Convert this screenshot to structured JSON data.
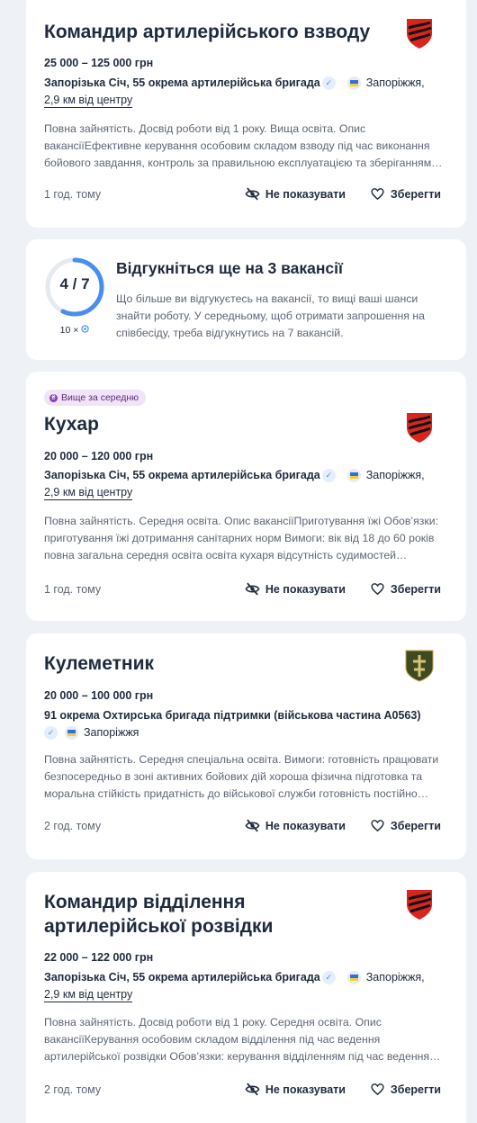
{
  "colors": {
    "background": "#eef2f6",
    "card": "#ffffff",
    "text": "#1f2b3d",
    "muted": "#5d6675",
    "accent": "#4a8df0",
    "badge_bg": "#f1e4f8"
  },
  "labels": {
    "hide": "Не показувати",
    "save": "Зберегти"
  },
  "jobs": [
    {
      "title": "Командир артилерійського взводу",
      "salary": "25 000 – 125 000 грн",
      "company": "Запорізька Січ, 55 окрема артилерійська бригада",
      "location": "Запоріжжя,",
      "distance": "2,9 км від центру",
      "description": "Повна зайнятість. Досвід роботи від 1 року. Вища освіта. Опис вакансіїЕфективне керування особовим складом взводу під час виконання бойового завдання, контроль за правильною експлуатацією та зберіганням…",
      "time": "1 год. тому",
      "logo": "red-black-emblem-icon"
    },
    {
      "badge": "Вище за середню",
      "title": "Кухар",
      "salary": "20 000 – 120 000 грн",
      "company": "Запорізька Січ, 55 окрема артилерійська бригада",
      "location": "Запоріжжя,",
      "distance": "2,9 км від центру",
      "description": "Повна зайнятість. Середня освіта. Опис вакансіїПриготування їжі Обов’язки: приготування їжі дотримання санітарних норм Вимоги: вік від 18 до 60 років повна загальна середня освіта освіта кухаря відсутність судимостей…",
      "time": "1 год. тому",
      "logo": "red-black-emblem-icon"
    },
    {
      "title": "Кулеметник",
      "salary": "20 000 – 100 000 грн",
      "company": "91 окрема Охтирська бригада підтримки (військова частина А0563)",
      "location": "Запоріжжя",
      "description": "Повна зайнятість. Середня спеціальна освіта. Вимоги: готовність працювати безпосередньо в зоні активних бойових дій хороша фізична підготовка та моральна стійкість придатність до військової служби готовність постійно…",
      "time": "2 год. тому",
      "logo": "olive-cross-emblem-icon"
    },
    {
      "title_line1": "Командир відділення",
      "title_line2": "артилерійської розвідки",
      "salary": "22 000 – 122 000 грн",
      "company": "Запорізька Січ, 55 окрема артилерійська бригада",
      "location": "Запоріжжя,",
      "distance": "2,9 км від центру",
      "description": "Повна зайнятість. Досвід роботи від 1 року. Середня освіта. Опис вакансіїКерування особовим складом відділення під час ведення артилерійської розвідки Обов’язки: керування відділенням під час ведення…",
      "time": "2 год. тому",
      "logo": "red-black-emblem-icon"
    }
  ],
  "promo": {
    "progress_text": "4 / 7",
    "progress_fraction": 0.571,
    "multiplier": "10 ×",
    "title": "Відгукніться ще на 3 вакансії",
    "text": "Що більше ви відгукуєтесь на вакансії, то вищі ваші шанси знайти роботу. У середньому, щоб отримати запрошення на співбесіду, треба відгукнутись на 7 вакансій."
  }
}
